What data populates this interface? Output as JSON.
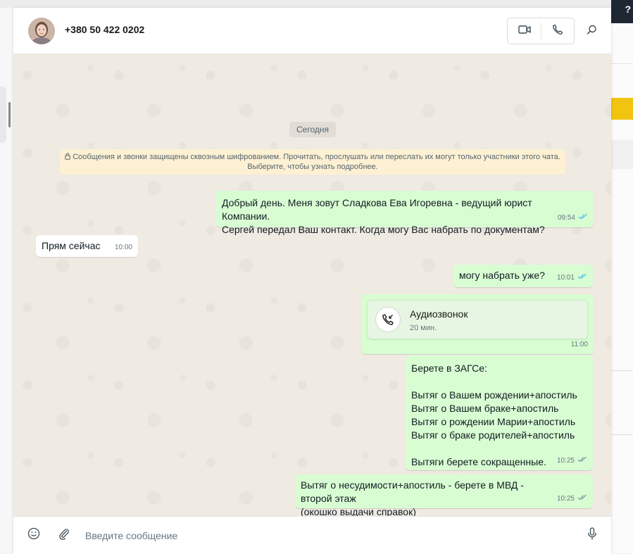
{
  "contact": {
    "phone": "+380 50 422 0202"
  },
  "icons": {
    "video": "video-camera-icon",
    "voice": "phone-icon",
    "search": "search-icon",
    "emoji": "emoji-icon",
    "attach": "paperclip-icon",
    "mic": "microphone-icon",
    "lock": "lock-icon"
  },
  "colors": {
    "outgoing": "#d9fdd3",
    "incoming": "#ffffff",
    "read_tick": "#53bdeb",
    "notice": "#fdf0d3"
  },
  "chat": {
    "date_label": "Сегодня",
    "encryption_notice": "Сообщения и звонки защищены сквозным шифрованием. Прочитать, прослушать или переслать их могут только участники этого чата.\nВыберите, чтобы узнать подробнее.",
    "messages": [
      {
        "dir": "out",
        "text": "Добрый день. Меня зовут Сладкова Ева Игоревна - ведущий юрист Компании.\nСергей передал Ваш контакт. Когда могу Вас набрать по документам?",
        "time": "09:54",
        "status": "read"
      },
      {
        "dir": "in",
        "text": "Прям сейчас",
        "time": "10:00"
      },
      {
        "dir": "out",
        "text": "могу набрать уже?",
        "time": "10:01",
        "status": "read"
      },
      {
        "dir": "out",
        "type": "call",
        "title": "Аудиозвонок",
        "subtitle": "20 мин.",
        "time": "11:00"
      },
      {
        "dir": "out",
        "text": "Берете в ЗАГСе:\n\nВытяг о Вашем рождении+апостиль\nВытяг о Вашем браке+апостиль\nВытяг о рождении Марии+апостиль\nВытяг о браке родителей+апостиль\n\nВытяги берете сокращенные.",
        "time": "10:25",
        "status": "delivered"
      },
      {
        "dir": "out",
        "text": "Вытяг о несудимости+апостиль - берете в МВД - второй этаж\n(окошко выдачи справок)",
        "time": "10:25",
        "status": "delivered"
      }
    ]
  },
  "composer": {
    "placeholder": "Введите сообщение"
  }
}
